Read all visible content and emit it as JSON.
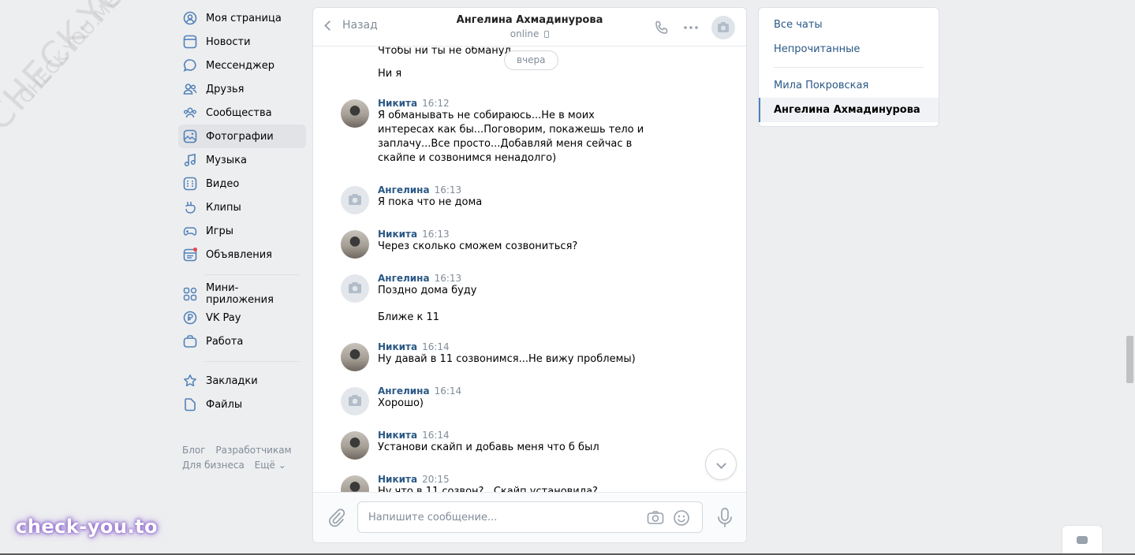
{
  "leftnav": {
    "items": [
      {
        "label": "Моя страница",
        "icon": "user-circle-icon"
      },
      {
        "label": "Новости",
        "icon": "news-icon"
      },
      {
        "label": "Мессенджер",
        "icon": "message-icon"
      },
      {
        "label": "Друзья",
        "icon": "friends-icon"
      },
      {
        "label": "Сообщества",
        "icon": "communities-icon"
      },
      {
        "label": "Фотографии",
        "icon": "photos-icon"
      },
      {
        "label": "Музыка",
        "icon": "music-icon"
      },
      {
        "label": "Видео",
        "icon": "video-icon"
      },
      {
        "label": "Клипы",
        "icon": "clips-icon"
      },
      {
        "label": "Игры",
        "icon": "games-icon"
      },
      {
        "label": "Объявления",
        "icon": "ads-icon"
      },
      {
        "label": "Мини-приложения",
        "icon": "apps-icon"
      },
      {
        "label": "VK Pay",
        "icon": "vkpay-icon"
      },
      {
        "label": "Работа",
        "icon": "work-icon"
      },
      {
        "label": "Закладки",
        "icon": "star-icon"
      },
      {
        "label": "Файлы",
        "icon": "file-icon"
      }
    ],
    "footer": {
      "blog": "Блог",
      "dev": "Разработчикам",
      "business": "Для бизнеса",
      "more": "Ещё ⌄"
    }
  },
  "chat": {
    "back_label": "Назад",
    "peer_name": "Ангелина Ахмадинурова",
    "peer_status": "online",
    "date_pill": "вчера",
    "composer_placeholder": "Напишите сообщение...",
    "messages": [
      {
        "author": "",
        "time": "",
        "text": "Чтобы ни ты не обманул"
      },
      {
        "author": "",
        "time": "",
        "text": "Ни я"
      },
      {
        "author": "Никита",
        "time": "16:12",
        "text": "Я обманывать не собираюсь...Не в моих интересах как бы...Поговорим, покажешь тело и заплачу...Все просто...Добавляй меня сейчас в скайпе и созвонимся ненадолго)"
      },
      {
        "author": "Ангелина",
        "time": "16:13",
        "text": "Я пока что не дома"
      },
      {
        "author": "Никита",
        "time": "16:13",
        "text": "Через сколько сможем созвониться?"
      },
      {
        "author": "Ангелина",
        "time": "16:13",
        "text": "Поздно дома буду"
      },
      {
        "author": "",
        "time": "",
        "text": "Ближе к 11"
      },
      {
        "author": "Никита",
        "time": "16:14",
        "text": "Ну давай в 11 созвонимся...Не вижу проблемы)"
      },
      {
        "author": "Ангелина",
        "time": "16:14",
        "text": "Хорошо)"
      },
      {
        "author": "Никита",
        "time": "16:14",
        "text": "Установи скайп и добавь меня что б был"
      },
      {
        "author": "Никита",
        "time": "20:15",
        "text": "Ну что в 11 созвон?...Скайп установила?"
      }
    ]
  },
  "rightpanel": {
    "all_chats": "Все чаты",
    "unread": "Непрочитанные",
    "chats": [
      "Мила Покровская",
      "Ангелина Ахмадинурова"
    ]
  },
  "watermark": {
    "corner": "check-you.to",
    "diagonal": "CHECK-YOU.ME"
  },
  "colors": {
    "link": "#2a5885",
    "accent": "#5181b8",
    "muted": "#818c99"
  }
}
